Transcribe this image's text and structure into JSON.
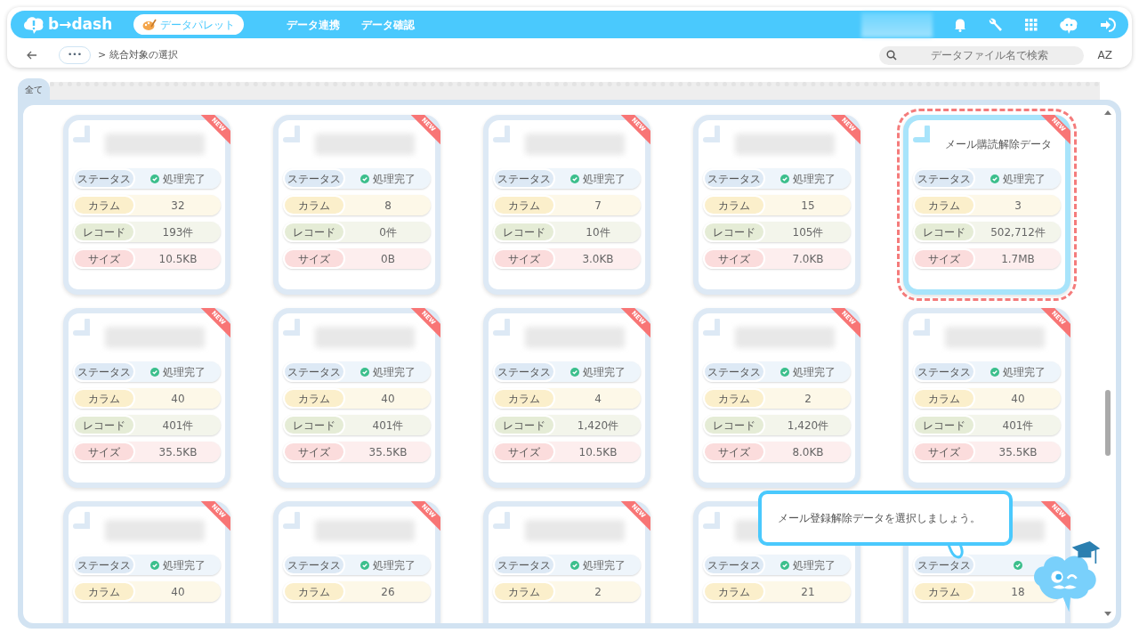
{
  "header": {
    "logo": "b→dash",
    "palette_button": "データパレット",
    "nav_links": [
      "データ連携",
      "データ確認"
    ]
  },
  "toolbar": {
    "crumb_more": "•••",
    "crumb_separator": ">",
    "crumb_current": "統合対象の選択",
    "search": {
      "placeholder": "データファイル名で検索"
    },
    "sort_button": "AZ"
  },
  "tabs": [
    {
      "label": "全て",
      "selected": true
    }
  ],
  "cards": [
    {
      "badge": "NEW",
      "selected": false,
      "fields": [
        {
          "kind": "status",
          "label": "ステータス",
          "value": "処理完了"
        },
        {
          "kind": "column",
          "label": "カラム",
          "value": "32"
        },
        {
          "kind": "record",
          "label": "レコード",
          "value": "193件"
        },
        {
          "kind": "size",
          "label": "サイズ",
          "value": "10.5KB"
        }
      ]
    },
    {
      "badge": "NEW",
      "selected": false,
      "fields": [
        {
          "kind": "status",
          "label": "ステータス",
          "value": "処理完了"
        },
        {
          "kind": "column",
          "label": "カラム",
          "value": "8"
        },
        {
          "kind": "record",
          "label": "レコード",
          "value": "0件"
        },
        {
          "kind": "size",
          "label": "サイズ",
          "value": "0B"
        }
      ]
    },
    {
      "badge": "NEW",
      "selected": false,
      "fields": [
        {
          "kind": "status",
          "label": "ステータス",
          "value": "処理完了"
        },
        {
          "kind": "column",
          "label": "カラム",
          "value": "7"
        },
        {
          "kind": "record",
          "label": "レコード",
          "value": "10件"
        },
        {
          "kind": "size",
          "label": "サイズ",
          "value": "3.0KB"
        }
      ]
    },
    {
      "badge": "NEW",
      "selected": false,
      "fields": [
        {
          "kind": "status",
          "label": "ステータス",
          "value": "処理完了"
        },
        {
          "kind": "column",
          "label": "カラム",
          "value": "15"
        },
        {
          "kind": "record",
          "label": "レコード",
          "value": "105件"
        },
        {
          "kind": "size",
          "label": "サイズ",
          "value": "7.0KB"
        }
      ]
    },
    {
      "badge": "NEW",
      "selected": true,
      "title": "メール購読解除データ",
      "fields": [
        {
          "kind": "status",
          "label": "ステータス",
          "value": "処理完了"
        },
        {
          "kind": "column",
          "label": "カラム",
          "value": "3"
        },
        {
          "kind": "record",
          "label": "レコード",
          "value": "502,712件"
        },
        {
          "kind": "size",
          "label": "サイズ",
          "value": "1.7MB"
        }
      ]
    },
    {
      "badge": "NEW",
      "selected": false,
      "fields": [
        {
          "kind": "status",
          "label": "ステータス",
          "value": "処理完了"
        },
        {
          "kind": "column",
          "label": "カラム",
          "value": "40"
        },
        {
          "kind": "record",
          "label": "レコード",
          "value": "401件"
        },
        {
          "kind": "size",
          "label": "サイズ",
          "value": "35.5KB"
        }
      ]
    },
    {
      "badge": "NEW",
      "selected": false,
      "fields": [
        {
          "kind": "status",
          "label": "ステータス",
          "value": "処理完了"
        },
        {
          "kind": "column",
          "label": "カラム",
          "value": "40"
        },
        {
          "kind": "record",
          "label": "レコード",
          "value": "401件"
        },
        {
          "kind": "size",
          "label": "サイズ",
          "value": "35.5KB"
        }
      ]
    },
    {
      "badge": "NEW",
      "selected": false,
      "fields": [
        {
          "kind": "status",
          "label": "ステータス",
          "value": "処理完了"
        },
        {
          "kind": "column",
          "label": "カラム",
          "value": "4"
        },
        {
          "kind": "record",
          "label": "レコード",
          "value": "1,420件"
        },
        {
          "kind": "size",
          "label": "サイズ",
          "value": "10.5KB"
        }
      ]
    },
    {
      "badge": "NEW",
      "selected": false,
      "fields": [
        {
          "kind": "status",
          "label": "ステータス",
          "value": "処理完了"
        },
        {
          "kind": "column",
          "label": "カラム",
          "value": "2"
        },
        {
          "kind": "record",
          "label": "レコード",
          "value": "1,420件"
        },
        {
          "kind": "size",
          "label": "サイズ",
          "value": "8.0KB"
        }
      ]
    },
    {
      "badge": "NEW",
      "selected": false,
      "fields": [
        {
          "kind": "status",
          "label": "ステータス",
          "value": "処理完了"
        },
        {
          "kind": "column",
          "label": "カラム",
          "value": "40"
        },
        {
          "kind": "record",
          "label": "レコード",
          "value": "401件"
        },
        {
          "kind": "size",
          "label": "サイズ",
          "value": "35.5KB"
        }
      ]
    },
    {
      "badge": "NEW",
      "selected": false,
      "fields": [
        {
          "kind": "status",
          "label": "ステータス",
          "value": "処理完了"
        },
        {
          "kind": "column",
          "label": "カラム",
          "value": "40"
        }
      ]
    },
    {
      "badge": "NEW",
      "selected": false,
      "fields": [
        {
          "kind": "status",
          "label": "ステータス",
          "value": "処理完了"
        },
        {
          "kind": "column",
          "label": "カラム",
          "value": "26"
        }
      ]
    },
    {
      "badge": "NEW",
      "selected": false,
      "fields": [
        {
          "kind": "status",
          "label": "ステータス",
          "value": "処理完了"
        },
        {
          "kind": "column",
          "label": "カラム",
          "value": "2"
        }
      ]
    },
    {
      "selected": false,
      "fields": [
        {
          "kind": "status",
          "label": "ステータス",
          "value": "処理完了"
        },
        {
          "kind": "column",
          "label": "カラム",
          "value": "21"
        }
      ]
    },
    {
      "badge": "NEW",
      "selected": false,
      "fields": [
        {
          "kind": "status",
          "label": "ステータス"
        },
        {
          "kind": "column",
          "label": "カラム",
          "value": "18"
        }
      ]
    }
  ],
  "tooltip": "メール登録解除データを選択しましょう。"
}
